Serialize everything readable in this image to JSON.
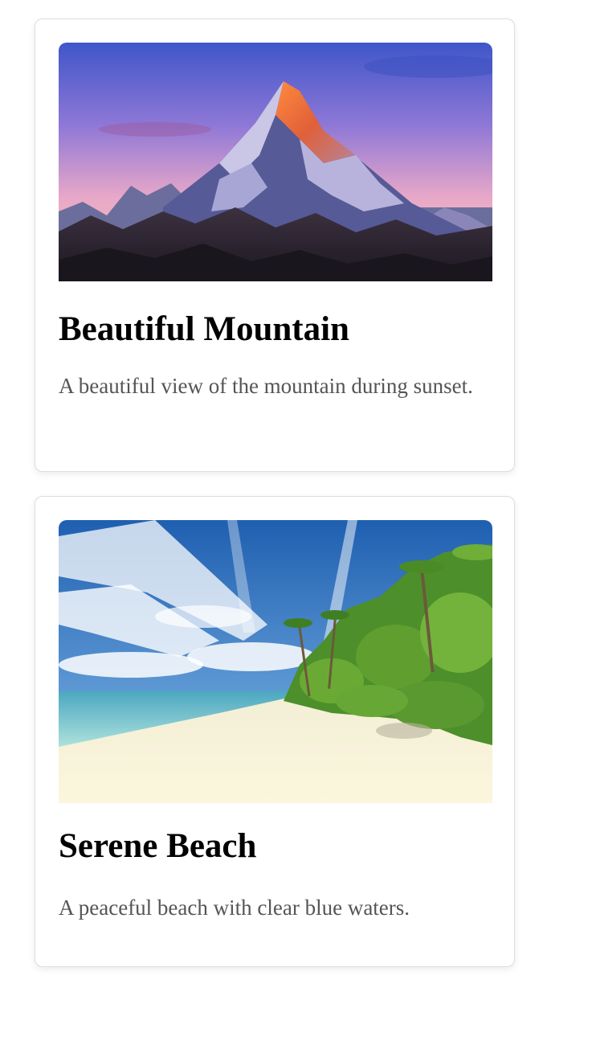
{
  "cards": [
    {
      "title": "Beautiful Mountain",
      "description": "A beautiful view of the mountain during sunset.",
      "image": "mountain-sunset-photo"
    },
    {
      "title": "Serene Beach",
      "description": "A peaceful beach with clear blue waters.",
      "image": "tropical-beach-photo"
    }
  ],
  "colors": {
    "card_border": "#dddddd",
    "title_text": "#000000",
    "description_text": "#555555"
  }
}
